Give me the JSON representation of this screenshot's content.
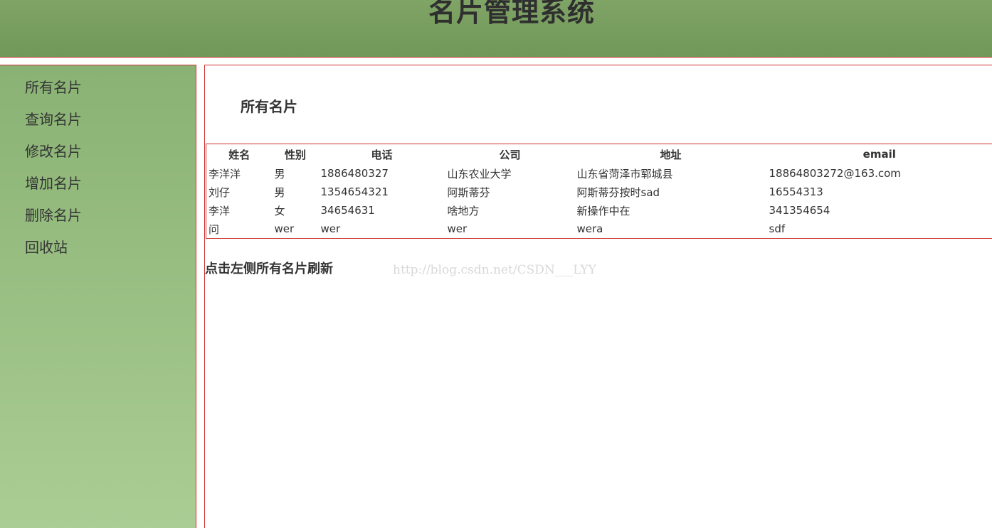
{
  "header": {
    "title": "名片管理系统"
  },
  "sidebar": {
    "items": [
      {
        "label": "所有名片"
      },
      {
        "label": "查询名片"
      },
      {
        "label": "修改名片"
      },
      {
        "label": "增加名片"
      },
      {
        "label": "删除名片"
      },
      {
        "label": "回收站"
      }
    ]
  },
  "main": {
    "title": "所有名片",
    "table": {
      "headers": [
        "姓名",
        "性别",
        "电话",
        "公司",
        "地址",
        "email"
      ],
      "rows": [
        [
          "李洋洋",
          "男",
          "1886480327",
          "山东农业大学",
          "山东省菏泽市郓城县",
          "18864803272@163.com"
        ],
        [
          "刘仔",
          "男",
          "1354654321",
          "阿斯蒂芬",
          "阿斯蒂芬按时sad",
          "16554313"
        ],
        [
          "李洋",
          "女",
          "34654631",
          "啥地方",
          "新操作中在",
          "341354654"
        ],
        [
          "问",
          "wer",
          "wer",
          "wer",
          "wera",
          "sdf"
        ]
      ]
    },
    "refresh_note": "点击左侧所有名片刷新"
  },
  "watermark": "http://blog.csdn.net/CSDN___LYY",
  "colors": {
    "header_bg": "#76995c",
    "sidebar_top": "#8ab274",
    "sidebar_bottom": "#aacd94",
    "border_red": "#cc3333",
    "text": "#333333"
  }
}
